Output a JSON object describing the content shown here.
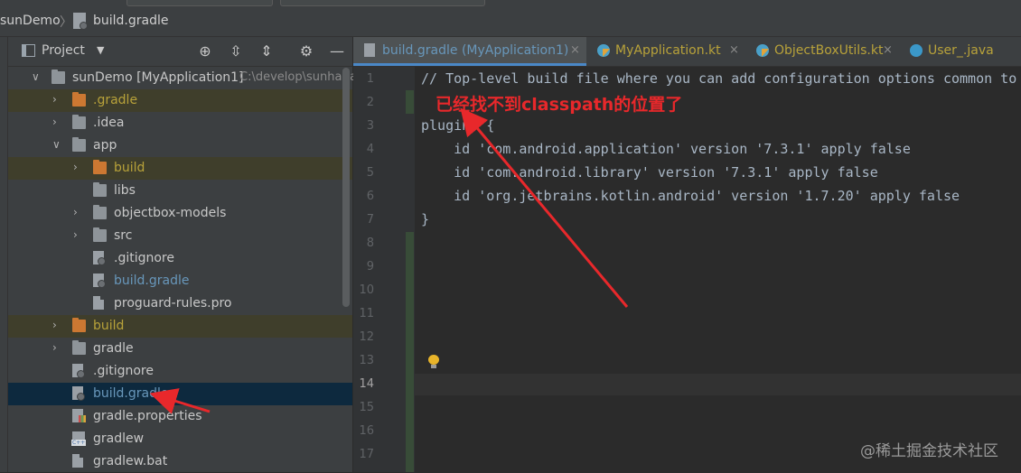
{
  "breadcrumb": {
    "project": "sunDemo",
    "separator": "〉",
    "file": "build.gradle"
  },
  "panel": {
    "title": "Project",
    "tree": [
      {
        "name": "root",
        "label": "sunDemo [MyApplication1]",
        "path": "C:\\develop\\sunhaita",
        "arrow": "∨",
        "kind": "module",
        "level": 0,
        "style": "normal"
      },
      {
        "name": "gradle-hidden",
        "label": ".gradle",
        "arrow": "›",
        "kind": "folder-orange",
        "level": 1,
        "style": "yellow"
      },
      {
        "name": "idea",
        "label": ".idea",
        "arrow": "›",
        "kind": "folder",
        "level": 1,
        "style": "normal"
      },
      {
        "name": "app",
        "label": "app",
        "arrow": "∨",
        "kind": "folder-module",
        "level": 1,
        "style": "normal"
      },
      {
        "name": "app-build",
        "label": "build",
        "arrow": "›",
        "kind": "folder-orange",
        "level": 2,
        "style": "yellow"
      },
      {
        "name": "libs",
        "label": "libs",
        "arrow": "",
        "kind": "folder",
        "level": 2,
        "style": "normal"
      },
      {
        "name": "objectbox-models",
        "label": "objectbox-models",
        "arrow": "›",
        "kind": "folder",
        "level": 2,
        "style": "normal"
      },
      {
        "name": "src",
        "label": "src",
        "arrow": "›",
        "kind": "folder",
        "level": 2,
        "style": "normal"
      },
      {
        "name": "app-gitignore",
        "label": ".gitignore",
        "arrow": "",
        "kind": "gradlefile",
        "level": 2,
        "style": "normal"
      },
      {
        "name": "app-build-gradle",
        "label": "build.gradle",
        "arrow": "",
        "kind": "gradlefile",
        "level": 2,
        "style": "blue"
      },
      {
        "name": "proguard",
        "label": "proguard-rules.pro",
        "arrow": "",
        "kind": "file",
        "level": 2,
        "style": "normal"
      },
      {
        "name": "build",
        "label": "build",
        "arrow": "›",
        "kind": "folder-orange",
        "level": 1,
        "style": "yellow"
      },
      {
        "name": "gradle",
        "label": "gradle",
        "arrow": "›",
        "kind": "folder",
        "level": 1,
        "style": "normal"
      },
      {
        "name": "root-gitignore",
        "label": ".gitignore",
        "arrow": "",
        "kind": "gradlefile",
        "level": 1,
        "style": "normal"
      },
      {
        "name": "root-build-gradle",
        "label": "build.gradle",
        "arrow": "",
        "kind": "gradlefile",
        "level": 1,
        "style": "selected"
      },
      {
        "name": "gradle-properties",
        "label": "gradle.properties",
        "arrow": "",
        "kind": "propfile",
        "level": 1,
        "style": "normal"
      },
      {
        "name": "gradlew",
        "label": "gradlew",
        "arrow": "",
        "kind": "cppfile",
        "level": 1,
        "style": "normal"
      },
      {
        "name": "gradlew-bat",
        "label": "gradlew.bat",
        "arrow": "",
        "kind": "file",
        "level": 1,
        "style": "normal"
      }
    ]
  },
  "tabs": [
    {
      "name": "tab-build-gradle",
      "label": "build.gradle (MyApplication1)",
      "icon": "gradle-file-icon",
      "active": true
    },
    {
      "name": "tab-myapplication",
      "label": "MyApplication.kt",
      "icon": "kotlin-class-icon",
      "active": false
    },
    {
      "name": "tab-objectboxutils",
      "label": "ObjectBoxUtils.kt",
      "icon": "kotlin-class-icon",
      "active": false
    },
    {
      "name": "tab-user-java",
      "label": "User_.java",
      "icon": "java-class-icon",
      "active": false
    }
  ],
  "editor": {
    "line_numbers": [
      "1",
      "2",
      "3",
      "4",
      "5",
      "6",
      "7",
      "8",
      "9",
      "10",
      "11",
      "12",
      "13",
      "14",
      "15",
      "16",
      "17"
    ],
    "current_line": 14,
    "lines": [
      "// Top-level build file where you can add configuration options common to",
      "",
      "plugins {",
      "    id 'com.android.application' version '7.3.1' apply false",
      "    id 'com.android.library' version '7.3.1' apply false",
      "    id 'org.jetbrains.kotlin.android' version '1.7.20' apply false",
      "}",
      "",
      "",
      "",
      "",
      "",
      "",
      "",
      "",
      "",
      ""
    ]
  },
  "annotation": {
    "text": "已经找不到classpath的位置了",
    "color": "#e8282b"
  },
  "watermark": "@稀土掘金技术社区",
  "colors": {
    "accent": "#4a88c7",
    "selection": "#0d293e",
    "excluded": "#3f3e2b",
    "annotation": "#e8282b"
  }
}
